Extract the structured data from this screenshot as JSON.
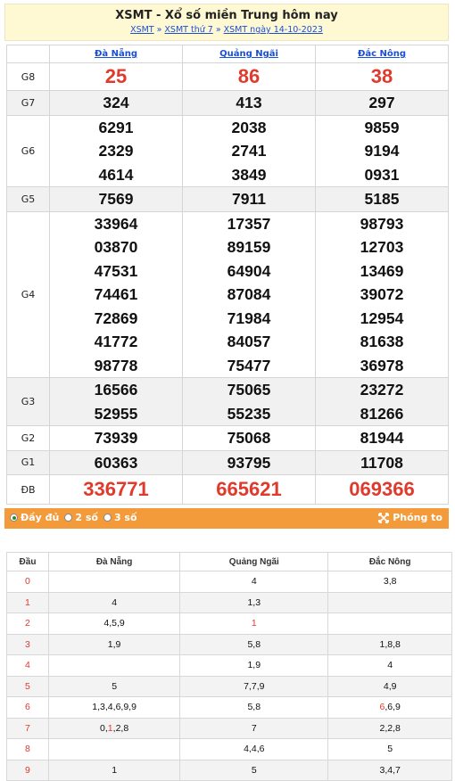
{
  "header": {
    "title": "XSMT - Xổ số miền Trung hôm nay",
    "crumbs": [
      "XSMT",
      "XSMT thứ 7",
      "XSMT ngày 14-10-2023"
    ],
    "sep": "»"
  },
  "provinces": [
    "Đà Nẵng",
    "Quảng Ngãi",
    "Đắc Nông"
  ],
  "prizes": [
    {
      "label": "G8",
      "vals": [
        [
          "25"
        ],
        [
          "86"
        ],
        [
          "38"
        ]
      ]
    },
    {
      "label": "G7",
      "vals": [
        [
          "324"
        ],
        [
          "413"
        ],
        [
          "297"
        ]
      ]
    },
    {
      "label": "G6",
      "vals": [
        [
          "6291",
          "2329",
          "4614"
        ],
        [
          "2038",
          "2741",
          "3849"
        ],
        [
          "9859",
          "9194",
          "0931"
        ]
      ]
    },
    {
      "label": "G5",
      "vals": [
        [
          "7569"
        ],
        [
          "7911"
        ],
        [
          "5185"
        ]
      ]
    },
    {
      "label": "G4",
      "vals": [
        [
          "33964",
          "03870",
          "47531",
          "74461",
          "72869",
          "41772",
          "98778"
        ],
        [
          "17357",
          "89159",
          "64904",
          "87084",
          "71984",
          "84057",
          "75477"
        ],
        [
          "98793",
          "12703",
          "13469",
          "39072",
          "12954",
          "81638",
          "36978"
        ]
      ]
    },
    {
      "label": "G3",
      "vals": [
        [
          "16566",
          "52955"
        ],
        [
          "75065",
          "55235"
        ],
        [
          "23272",
          "81266"
        ]
      ]
    },
    {
      "label": "G2",
      "vals": [
        [
          "73939"
        ],
        [
          "75068"
        ],
        [
          "81944"
        ]
      ]
    },
    {
      "label": "G1",
      "vals": [
        [
          "60363"
        ],
        [
          "93795"
        ],
        [
          "11708"
        ]
      ]
    },
    {
      "label": "ĐB",
      "vals": [
        [
          "336771"
        ],
        [
          "665621"
        ],
        [
          "069366"
        ]
      ]
    }
  ],
  "options": {
    "full": "Đầy đủ",
    "two": "2 số",
    "three": "3 số",
    "zoom": "Phóng to"
  },
  "loto": {
    "head_label": "Đầu",
    "rows": [
      {
        "h": "0",
        "c": [
          "",
          "4",
          "3,8"
        ]
      },
      {
        "h": "1",
        "c": [
          "4",
          "1,3",
          ""
        ]
      },
      {
        "h": "2",
        "c": [
          "4,5,9",
          "1",
          ""
        ]
      },
      {
        "h": "3",
        "c": [
          "1,9",
          "5,8",
          "1,8,8"
        ]
      },
      {
        "h": "4",
        "c": [
          "",
          "1,9",
          "4"
        ]
      },
      {
        "h": "5",
        "c": [
          "5",
          "7,7,9",
          "4,9"
        ]
      },
      {
        "h": "6",
        "c": [
          "1,3,4,6,9,9",
          "5,8",
          "6,6,9"
        ]
      },
      {
        "h": "7",
        "c": [
          "0,1,2,8",
          "7",
          "2,2,8"
        ]
      },
      {
        "h": "8",
        "c": [
          "",
          "4,4,6",
          "5"
        ]
      },
      {
        "h": "9",
        "c": [
          "1",
          "5",
          "3,4,7"
        ]
      }
    ]
  },
  "colors": {
    "accent": "#e03a2c",
    "bar": "#f39a3a",
    "link": "#1a4fd8",
    "header_bg": "#fef8d3"
  }
}
